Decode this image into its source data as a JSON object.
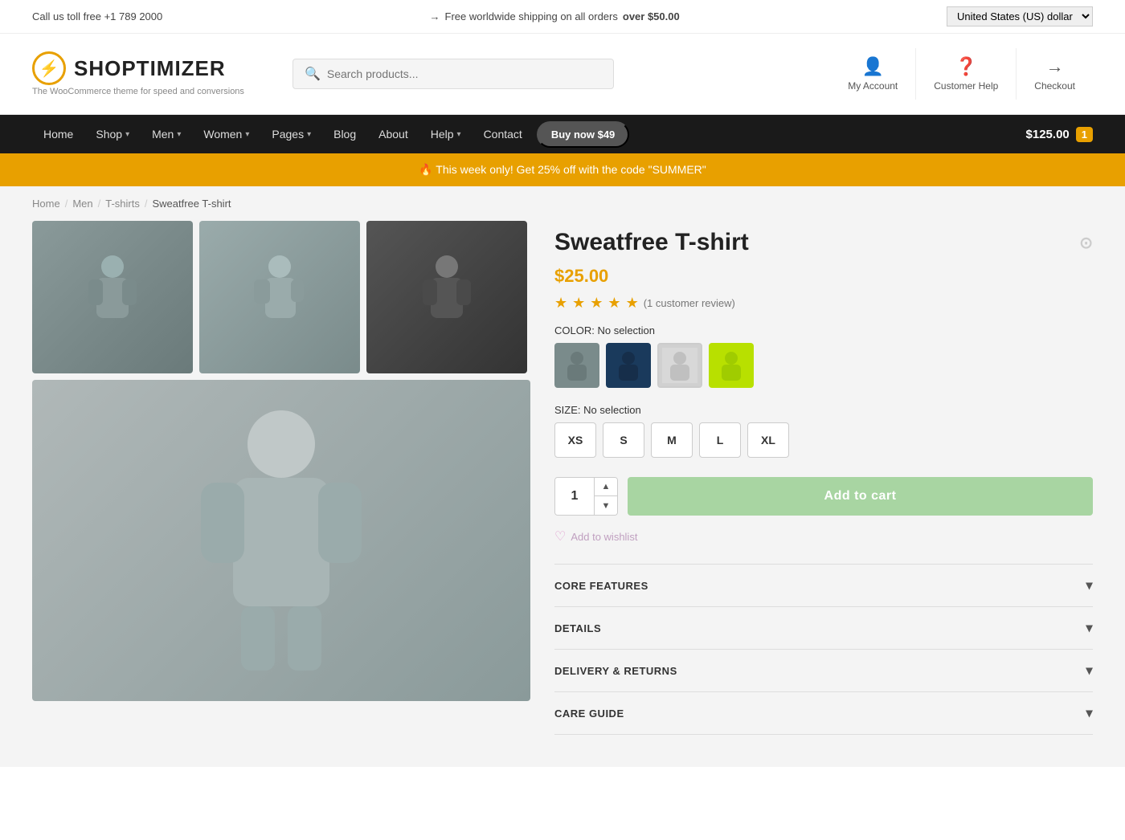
{
  "topbar": {
    "phone": "Call us toll free +1 789 2000",
    "shipping": "Free worldwide shipping on all orders",
    "shipping_highlight": "over $50.00",
    "shipping_icon": "→",
    "currency": "United States (US) dollar"
  },
  "header": {
    "logo_text": "SHOPTIMIZER",
    "logo_tagline": "The WooCommerce theme for speed and conversions",
    "logo_icon": "⚡",
    "search_placeholder": "Search products...",
    "my_account_label": "My Account",
    "customer_help_label": "Customer Help",
    "checkout_label": "Checkout"
  },
  "nav": {
    "items": [
      {
        "label": "Home",
        "has_dropdown": false
      },
      {
        "label": "Shop",
        "has_dropdown": true
      },
      {
        "label": "Men",
        "has_dropdown": true
      },
      {
        "label": "Women",
        "has_dropdown": true
      },
      {
        "label": "Pages",
        "has_dropdown": true
      },
      {
        "label": "Blog",
        "has_dropdown": false
      },
      {
        "label": "About",
        "has_dropdown": false
      },
      {
        "label": "Help",
        "has_dropdown": true
      },
      {
        "label": "Contact",
        "has_dropdown": false
      }
    ],
    "buy_btn_label": "Buy now $49",
    "cart_price": "$125.00",
    "cart_count": "1"
  },
  "promo": {
    "icon": "🔥",
    "text": "This week only! Get 25% off with the code \"SUMMER\""
  },
  "breadcrumb": {
    "items": [
      "Home",
      "Men",
      "T-shirts",
      "Sweatfree T-shirt"
    ]
  },
  "product": {
    "title": "Sweatfree T-shirt",
    "price": "$25.00",
    "stars": 5,
    "review_count": "(1 customer review)",
    "color_label": "COLOR:",
    "color_value": "No selection",
    "size_label": "SIZE:",
    "size_value": "No selection",
    "sizes": [
      "XS",
      "S",
      "M",
      "L",
      "XL"
    ],
    "quantity": "1",
    "add_to_cart_label": "Add to cart",
    "wishlist_label": "Add to wishlist",
    "accordions": [
      {
        "label": "CORE FEATURES"
      },
      {
        "label": "DETAILS"
      },
      {
        "label": "DELIVERY & RETURNS"
      },
      {
        "label": "CARE GUIDE"
      }
    ]
  }
}
